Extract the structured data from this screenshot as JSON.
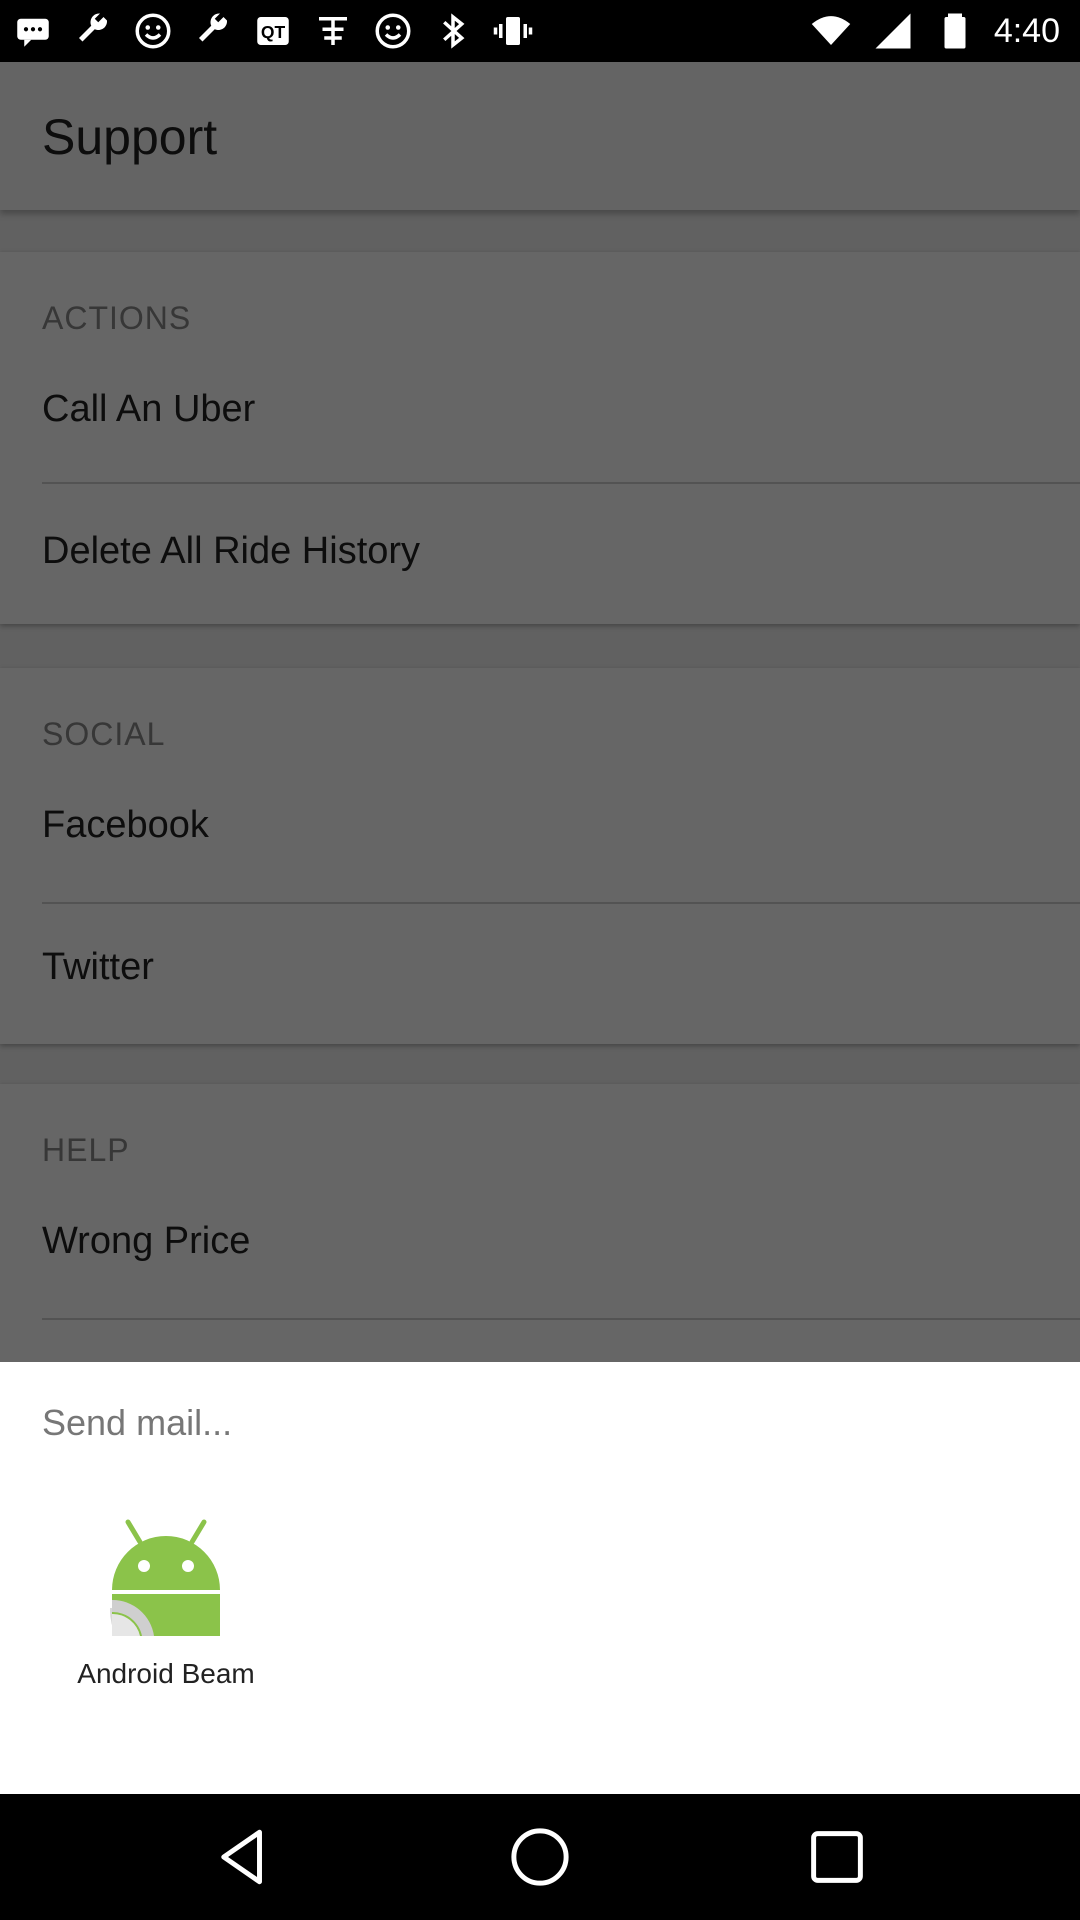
{
  "status_bar": {
    "time": "4:40",
    "left_icons": [
      "messages-icon",
      "wrench-icon",
      "smiley-icon",
      "wrench-icon",
      "qq-icon",
      "font-icon",
      "smiley-icon",
      "bluetooth-icon",
      "vibrate-icon"
    ],
    "right_icons": [
      "wifi-icon",
      "signal-icon",
      "battery-icon"
    ]
  },
  "app": {
    "title": "Support",
    "sections": [
      {
        "header": "ACTIONS",
        "items": [
          "Call An Uber",
          "Delete All Ride History"
        ]
      },
      {
        "header": "SOCIAL",
        "items": [
          "Facebook",
          "Twitter"
        ]
      },
      {
        "header": "HELP",
        "items": [
          "Wrong Price"
        ]
      }
    ]
  },
  "share_sheet": {
    "title": "Send mail...",
    "targets": [
      {
        "label": "Android Beam",
        "icon": "android-beam-icon"
      }
    ]
  },
  "colors": {
    "android_green": "#8bc34a",
    "scrim": "rgba(0,0,0,0.6)"
  },
  "nav_bar": {
    "buttons": [
      "back-icon",
      "home-icon",
      "recents-icon"
    ]
  }
}
